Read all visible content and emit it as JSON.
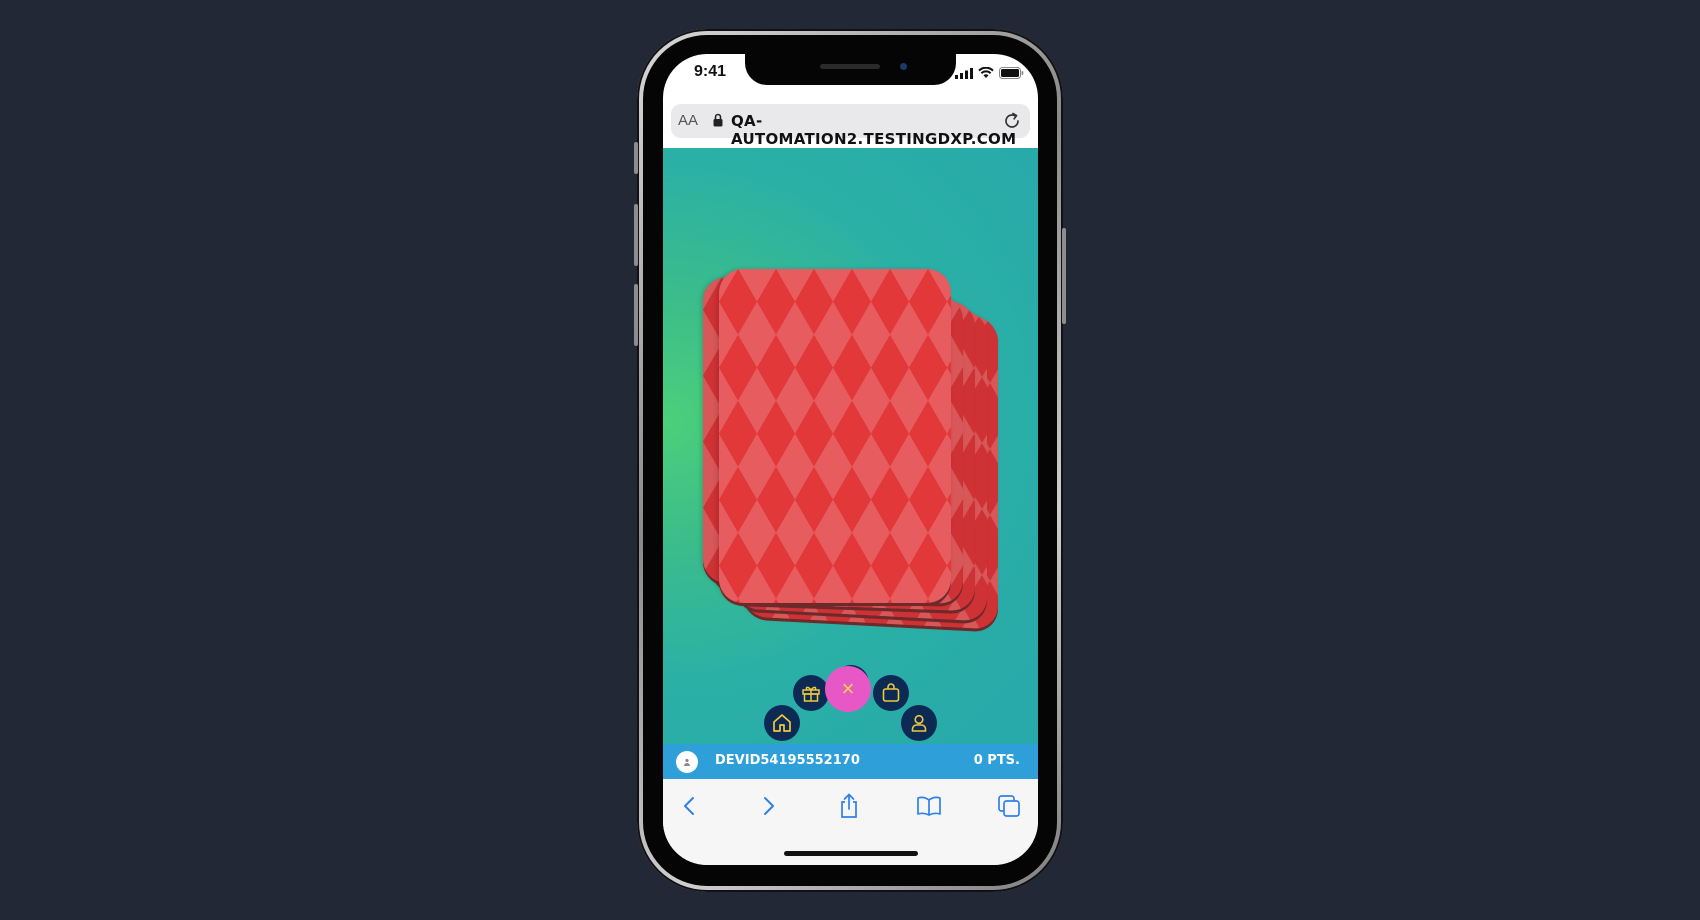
{
  "status_bar": {
    "time": "9:41"
  },
  "browser": {
    "text_size_label": "AA",
    "url": "QA-AUTOMATION2.TESTINGDXP.COM"
  },
  "game": {
    "menu": {
      "home_icon": "home-icon",
      "gift_icon": "gift-icon",
      "help_label": "?",
      "bag_icon": "shopping-bag-icon",
      "profile_icon": "user-icon",
      "close_label": "×"
    }
  },
  "user_bar": {
    "username": "DEVID54195552170",
    "points": "0 PTS."
  },
  "colors": {
    "page_background": "#222836",
    "card_red": "#e2383a",
    "menu_button": "#0d2a55",
    "menu_icon": "#f0c93a",
    "close_button": "#e757c6",
    "user_bar": "#2e9fd8"
  }
}
